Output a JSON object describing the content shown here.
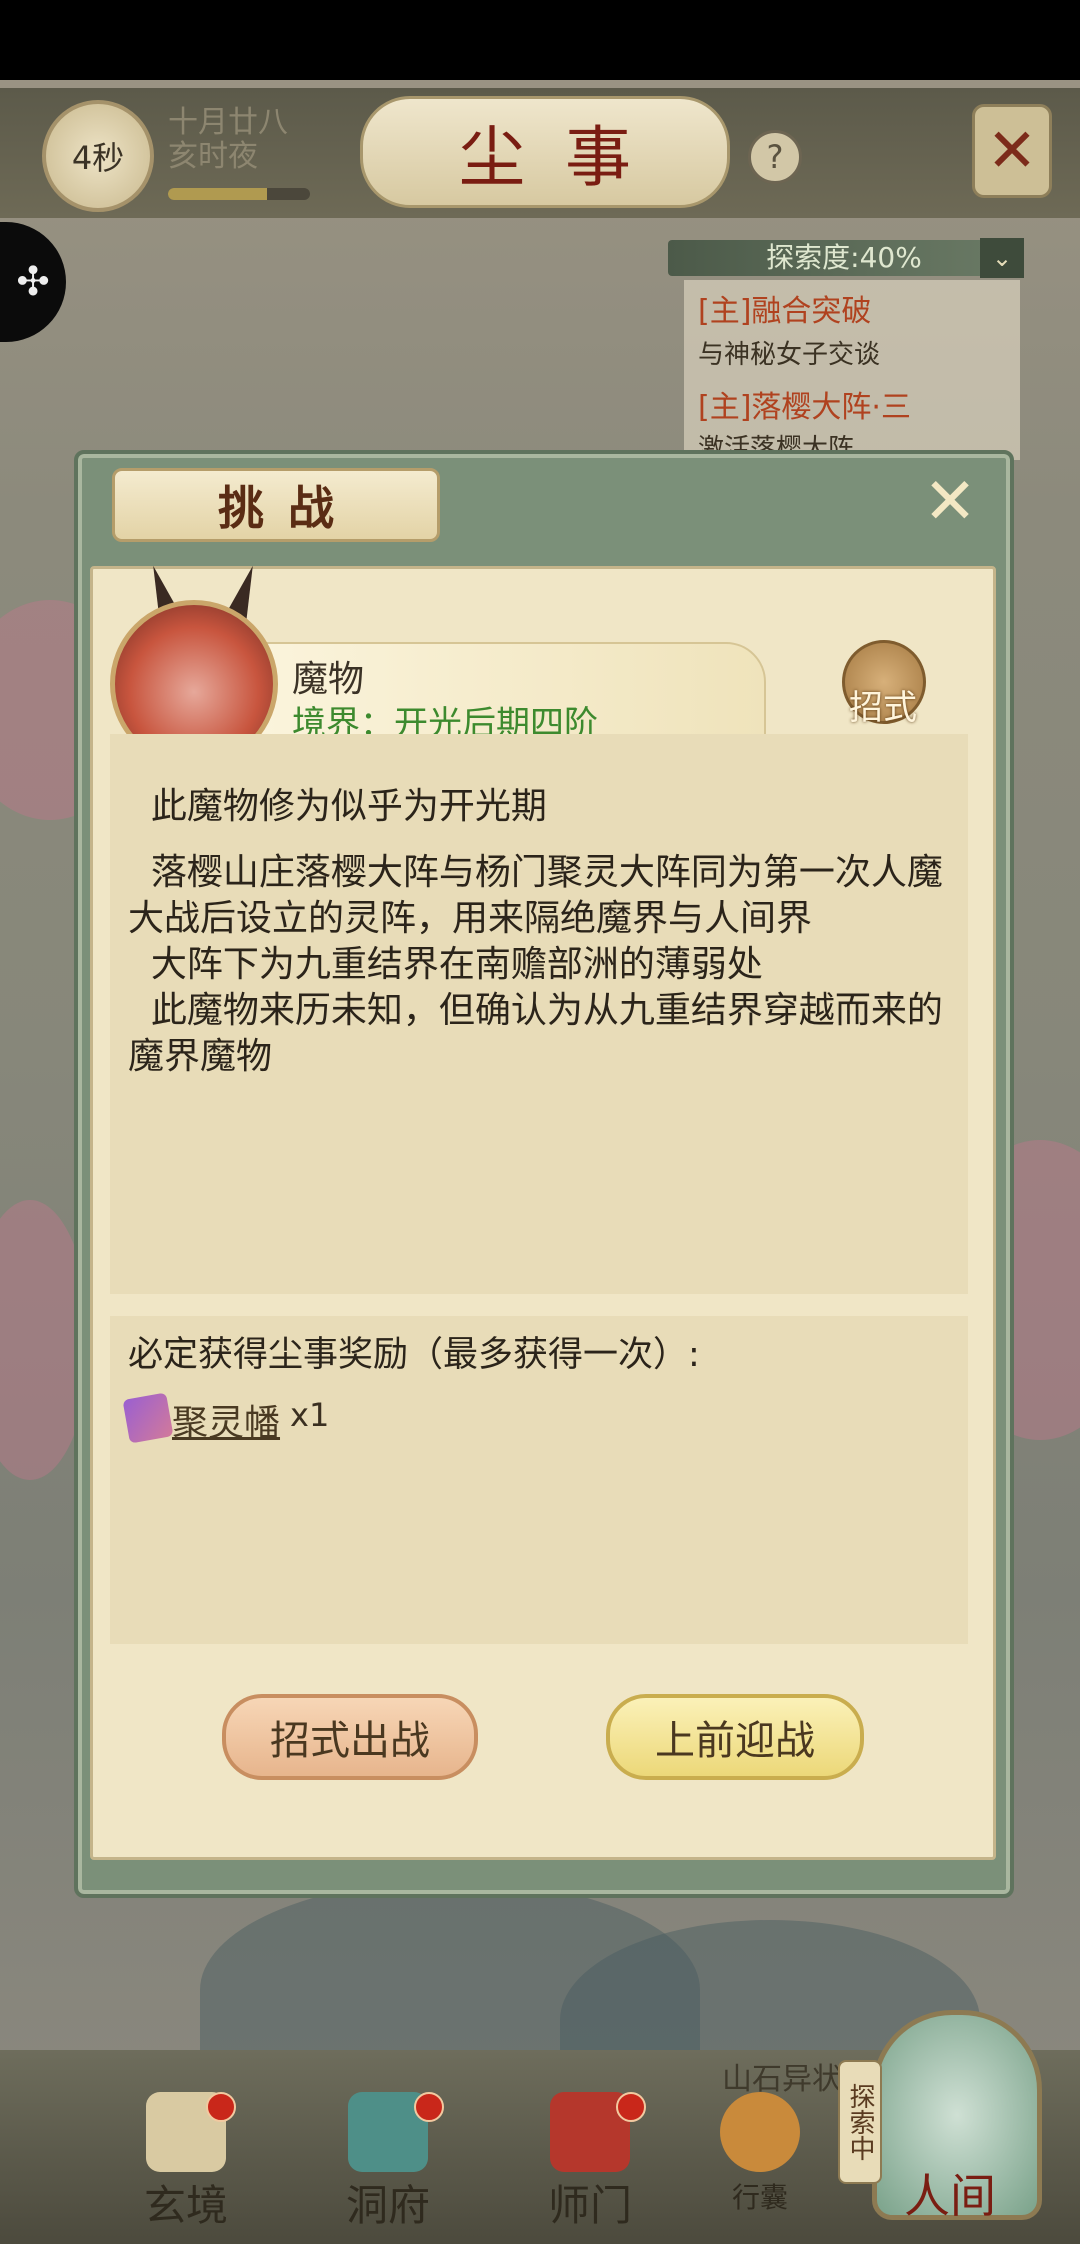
{
  "header": {
    "timer": "4秒",
    "date_line1": "十月廿八",
    "date_line2": "亥时夜",
    "time_progress_percent": 70,
    "title": "尘事",
    "help_label": "?",
    "close_label": "✕",
    "side_tab_icon": "puzzle-icon"
  },
  "quest_panel": {
    "explore_label": "探索度:40%",
    "toggle_icon": "chevron-down-icon",
    "quests": [
      {
        "title": "[主]融合突破",
        "subtitle": "与神秘女子交谈"
      },
      {
        "title": "[主]落樱大阵·三",
        "subtitle": "激活落樱大阵"
      }
    ]
  },
  "dialog": {
    "title": "挑战",
    "close_label": "✕",
    "monster": {
      "name": "魔物",
      "realm": "境界：开光后期四阶",
      "moves_label": "招式"
    },
    "description": [
      "  此魔物修为似乎为开光期",
      "  落樱山庄落樱大阵与杨门聚灵大阵同为第一次人魔大战后设立的灵阵，用来隔绝魔界与人间界",
      "  大阵下为九重结界在南赡部洲的薄弱处",
      "  此魔物来历未知，但确认为从九重结界穿越而来的魔界魔物"
    ],
    "reward": {
      "heading": "必定获得尘事奖励（最多获得一次）:",
      "item_name": "聚灵幡",
      "item_qty": "x1"
    },
    "buttons": {
      "moves_fight": "招式出战",
      "fight": "上前迎战"
    }
  },
  "bottom_nav": {
    "items": [
      {
        "label": "玄境"
      },
      {
        "label": "洞府"
      },
      {
        "label": "师门"
      },
      {
        "label": "行囊"
      }
    ],
    "explore_tag": "探索中",
    "world_label": "人间",
    "background_place": "山石异状"
  },
  "colors": {
    "realm_green": "#3d8a2e",
    "title_red": "#7a1d12",
    "quest_orange": "#b0421f",
    "badge_red": "#c9271a"
  }
}
